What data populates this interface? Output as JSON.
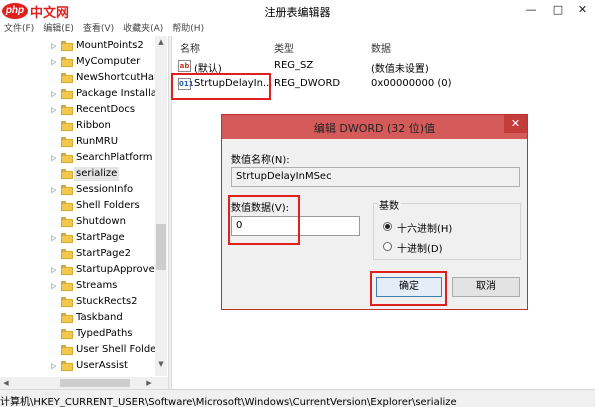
{
  "window": {
    "logo_php": "php",
    "logo_text": "中文网",
    "title": "注册表编辑器",
    "min_glyph": "—",
    "max_glyph": "□",
    "close_glyph": "✕"
  },
  "menu": [
    "文件(F)",
    "编辑(E)",
    "查看(V)",
    "收藏夹(A)",
    "帮助(H)"
  ],
  "tree": {
    "items": [
      {
        "label": "MountPoints2",
        "expander": "▷"
      },
      {
        "label": "MyComputer",
        "expander": "▷"
      },
      {
        "label": "NewShortcutHan",
        "expander": ""
      },
      {
        "label": "Package Installat",
        "expander": "▷"
      },
      {
        "label": "RecentDocs",
        "expander": "▷"
      },
      {
        "label": "Ribbon",
        "expander": ""
      },
      {
        "label": "RunMRU",
        "expander": ""
      },
      {
        "label": "SearchPlatform",
        "expander": "▷"
      },
      {
        "label": "serialize",
        "expander": ""
      },
      {
        "label": "SessionInfo",
        "expander": "▷"
      },
      {
        "label": "Shell Folders",
        "expander": ""
      },
      {
        "label": "Shutdown",
        "expander": ""
      },
      {
        "label": "StartPage",
        "expander": "▷"
      },
      {
        "label": "StartPage2",
        "expander": ""
      },
      {
        "label": "StartupApproved",
        "expander": "▷"
      },
      {
        "label": "Streams",
        "expander": "▷"
      },
      {
        "label": "StuckRects2",
        "expander": ""
      },
      {
        "label": "Taskband",
        "expander": ""
      },
      {
        "label": "TypedPaths",
        "expander": ""
      },
      {
        "label": "User Shell Folder",
        "expander": ""
      },
      {
        "label": "UserAssist",
        "expander": "▷"
      }
    ],
    "selected_index": 8
  },
  "scroll": {
    "up": "▲",
    "down": "▼",
    "left": "◀",
    "right": "▶"
  },
  "values": {
    "headers": {
      "name": "名称",
      "type": "类型",
      "data": "数据"
    },
    "rows": [
      {
        "icon": "ab",
        "name": "(默认)",
        "type": "REG_SZ",
        "data": "(数值未设置)"
      },
      {
        "icon": "011",
        "name": "StrtupDelayIn...",
        "type": "REG_DWORD",
        "data": "0x00000000 (0)"
      }
    ]
  },
  "dialog": {
    "title": "编辑 DWORD (32 位)值",
    "close_glyph": "✕",
    "name_label": "数值名称(N):",
    "name_value": "StrtupDelayInMSec",
    "data_label": "数值数据(V):",
    "data_value": "0",
    "base_label": "基数",
    "radio_hex": "十六进制(H)",
    "radio_dec": "十进制(D)",
    "ok_label": "确定",
    "cancel_label": "取消"
  },
  "statusbar": {
    "path": "计算机\\HKEY_CURRENT_USER\\Software\\Microsoft\\Windows\\CurrentVersion\\Explorer\\serialize"
  }
}
